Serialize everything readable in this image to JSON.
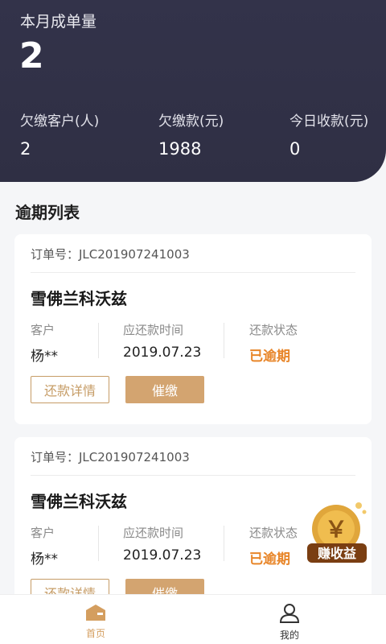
{
  "header": {
    "month_label": "本月成单量",
    "month_value": "2",
    "stats": [
      {
        "label": "欠缴客户(人)",
        "value": "2"
      },
      {
        "label": "欠缴款(元)",
        "value": "1988"
      },
      {
        "label": "今日收款(元)",
        "value": "0"
      }
    ]
  },
  "section_title": "逾期列表",
  "cards": [
    {
      "order": "订单号：JLC201907241003",
      "product": "雪佛兰科沃兹",
      "customer_label": "客户",
      "customer_value": "杨**",
      "due_label": "应还款时间",
      "due_value": "2019.07.23",
      "status_label": "还款状态",
      "status_value": "已逾期",
      "detail_button": "还款详情",
      "urge_button": "催缴"
    },
    {
      "order": "订单号：JLC201907241003",
      "product": "雪佛兰科沃兹",
      "customer_label": "客户",
      "customer_value": "杨**",
      "due_label": "应还款时间",
      "due_value": "2019.07.23",
      "status_label": "还款状态",
      "status_value": "已逾期",
      "detail_button": "还款详情",
      "urge_button": "催缴"
    }
  ],
  "fab": {
    "symbol": "￥",
    "label": "赚收益"
  },
  "tabbar": {
    "items": [
      {
        "label": "首页",
        "icon": "home-icon"
      },
      {
        "label": "我的",
        "icon": "user-icon"
      }
    ]
  },
  "colors": {
    "header_bg": "#2f2f44",
    "accent": "#d3a470",
    "overdue": "#e8862a"
  }
}
